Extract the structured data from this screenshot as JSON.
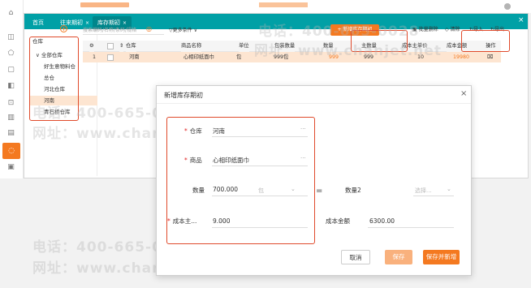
{
  "tabs": [
    {
      "label": "首页",
      "closable": false,
      "active": false
    },
    {
      "label": "往来期初",
      "closable": true,
      "active": false
    },
    {
      "label": "库存期初",
      "closable": true,
      "active": true
    }
  ],
  "close_glyph": "×",
  "tree": {
    "title": "仓库",
    "root": "全部仓库",
    "items": [
      "好生意物料仓",
      "总仓",
      "河北仓库",
      "河南",
      "青石桥仓库"
    ],
    "selected": "河南",
    "expand_glyph": "∨"
  },
  "rail_icons": [
    "home-icon",
    "gift-icon",
    "shop-icon",
    "box-icon",
    "briefcase-icon",
    "lock-icon",
    "chart-icon",
    "list-icon",
    "grid-icon",
    "inventory-icon",
    "document-icon"
  ],
  "toolbar": {
    "add_glyph": "+",
    "search_placeholder": "搜索编码/名称/条码/规格",
    "filter_glyph": "◎",
    "more_filter_label": "更多条件",
    "new_label": "+ 新增库存期初",
    "batch_delete_label": "批量删除",
    "clear_label": "清除",
    "import_label": "导入",
    "export_label": "导出"
  },
  "table": {
    "columns": [
      "",
      "",
      "仓库",
      "商品名称",
      "单位",
      "包装数量",
      "数量",
      "主数量",
      "成本主单价",
      "成本金额",
      "操作"
    ],
    "rows": [
      {
        "index": "1",
        "warehouse": "河南",
        "product": "心相印纸面巾",
        "unit": "包",
        "pack_qty": "999包",
        "qty": "999",
        "main_qty": "999",
        "unit_cost": "10",
        "amount": "19980"
      }
    ]
  },
  "modal": {
    "title": "新增库存期初",
    "warehouse_label": "仓库",
    "warehouse_value": "河南",
    "product_label": "商品",
    "product_value": "心相印纸面巾",
    "qty_label": "数量",
    "qty_value": "700.000",
    "qty_unit": "包",
    "equals": "=",
    "qty2_label": "数量2",
    "select_placeholder": "选择...",
    "unit_cost_label": "成本主...",
    "unit_cost_value": "9.000",
    "amount_label": "成本金额",
    "amount_value": "6300.00",
    "ellipsis": "···",
    "cancel_label": "取消",
    "save_label": "保存",
    "save_new_label": "保存并新增"
  },
  "watermark": {
    "phone": "电话：400-665-0028",
    "site": "网址：www.chanjet.net"
  },
  "colors": {
    "accent": "#f47920",
    "tabbar": "#00a0a6",
    "highlight": "#e04a2b",
    "selected_row": "#fde5d1"
  }
}
